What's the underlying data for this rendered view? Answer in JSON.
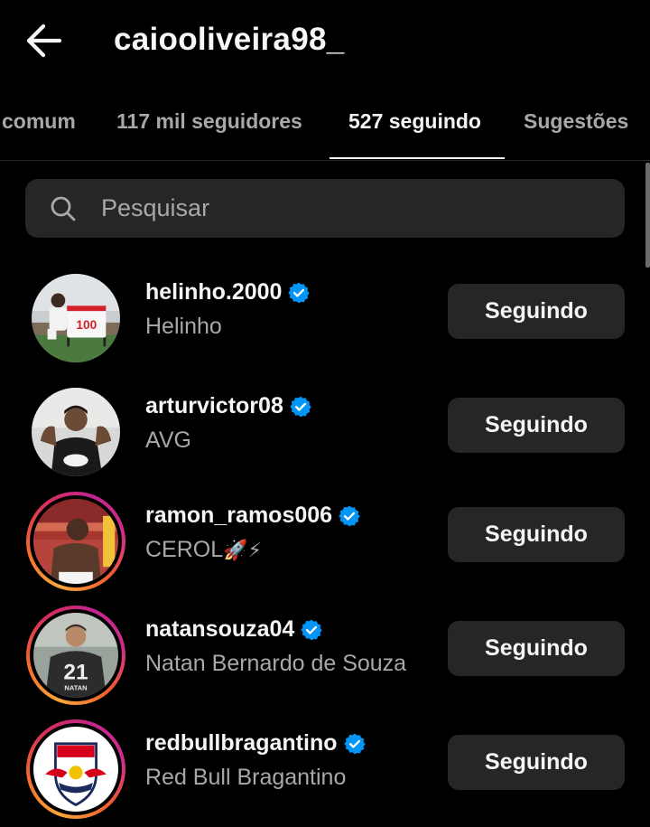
{
  "header": {
    "title": "caiooliveira98_",
    "back_icon": "arrow-left-icon"
  },
  "tabs": [
    {
      "label": "comum",
      "active": false
    },
    {
      "label": "117 mil seguidores",
      "active": false
    },
    {
      "label": "527 seguindo",
      "active": true
    },
    {
      "label": "Sugestões",
      "active": false
    }
  ],
  "search": {
    "placeholder": "Pesquisar",
    "value": "",
    "icon": "search-icon"
  },
  "accounts": [
    {
      "username": "helinho.2000",
      "fullname": "Helinho",
      "verified": true,
      "story_ring": false,
      "button": "Seguindo"
    },
    {
      "username": "arturvictor08",
      "fullname": "AVG",
      "verified": true,
      "story_ring": false,
      "button": "Seguindo"
    },
    {
      "username": "ramon_ramos006",
      "fullname": "CEROL",
      "fullname_emoji": "🚀⚡",
      "verified": true,
      "story_ring": true,
      "button": "Seguindo"
    },
    {
      "username": "natansouza04",
      "fullname": "Natan Bernardo de Souza",
      "verified": true,
      "story_ring": true,
      "button": "Seguindo"
    },
    {
      "username": "redbullbragantino",
      "fullname": "Red Bull Bragantino",
      "verified": true,
      "story_ring": true,
      "button": "Seguindo"
    }
  ],
  "colors": {
    "background": "#000000",
    "button": "#262626",
    "verified": "#0095f6",
    "secondary_text": "#a8a8a8"
  }
}
